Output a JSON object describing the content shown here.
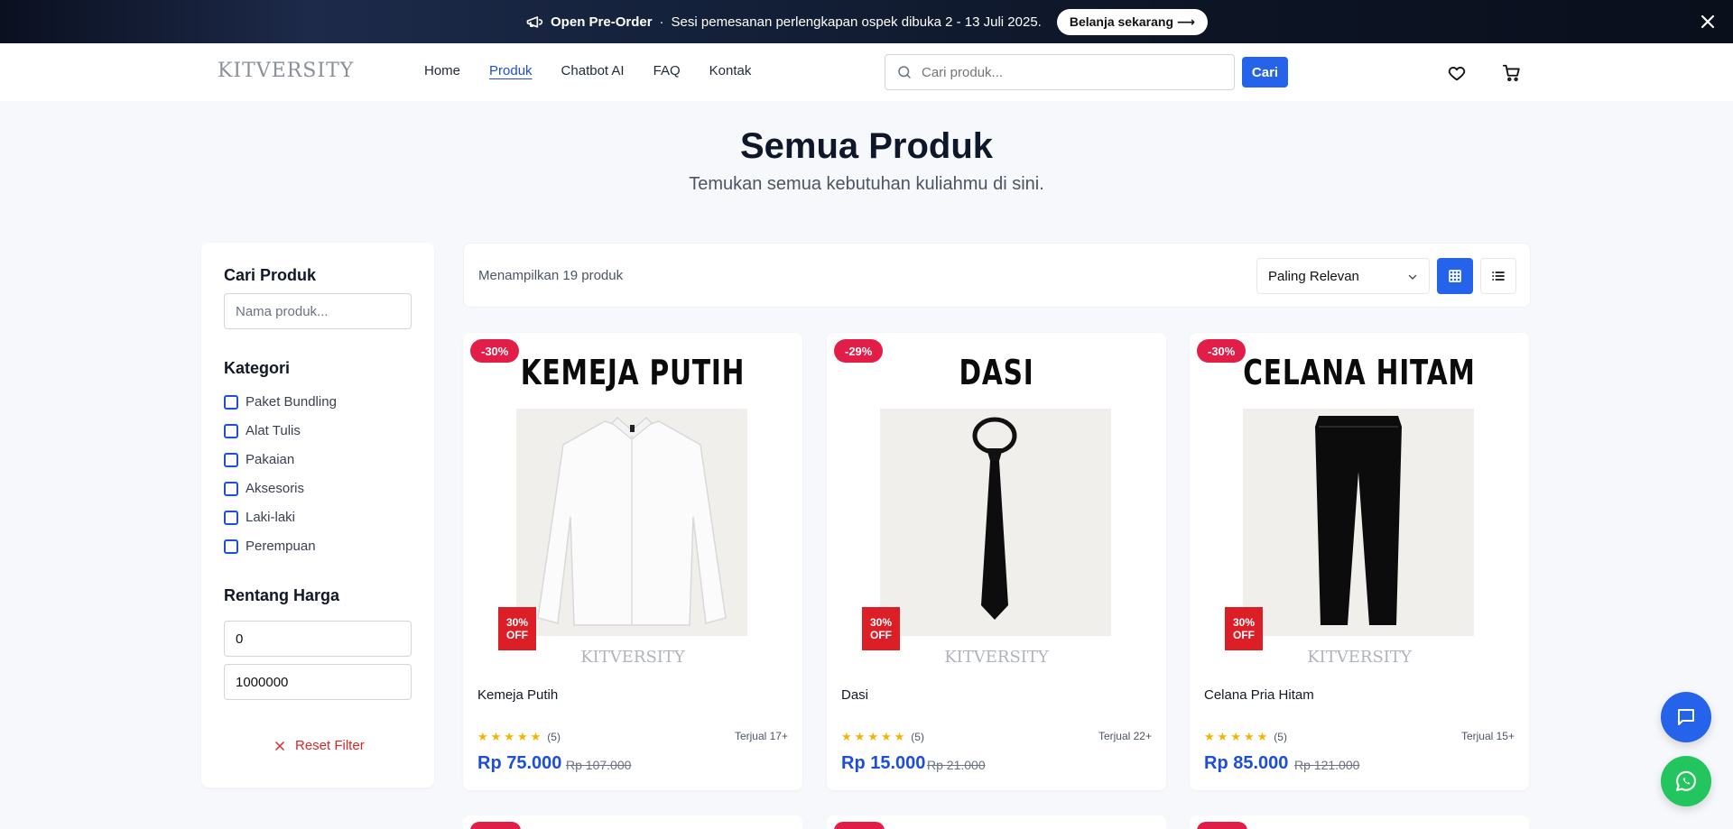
{
  "announcement": {
    "title": "Open Pre-Order",
    "separator": "·",
    "message": "Sesi pemesanan perlengkapan ospek dibuka 2 - 13 Juli 2025.",
    "cta": "Belanja sekarang ⟶"
  },
  "nav": {
    "logo": "KITVERSITY",
    "links": [
      "Home",
      "Produk",
      "Chatbot AI",
      "FAQ",
      "Kontak"
    ],
    "active_link": "Produk",
    "search_placeholder": "Cari produk...",
    "search_button": "Cari"
  },
  "hero": {
    "title": "Semua Produk",
    "subtitle": "Temukan semua kebutuhan kuliahmu di sini."
  },
  "sidebar": {
    "search_heading": "Cari Produk",
    "search_placeholder": "Nama produk...",
    "category_heading": "Kategori",
    "categories": [
      "Paket Bundling",
      "Alat Tulis",
      "Pakaian",
      "Aksesoris",
      "Laki-laki",
      "Perempuan"
    ],
    "price_heading": "Rentang Harga",
    "price_min": "0",
    "price_max": "1000000",
    "reset_label": "Reset Filter"
  },
  "toolbar": {
    "count_text": "Menampilkan 19 produk",
    "sort_value": "Paling Relevan"
  },
  "products": [
    {
      "badge": "-30%",
      "art_title": "KEMEJA PUTIH",
      "off_line1": "30%",
      "off_line2": "OFF",
      "watermark": "KITVERSITY",
      "name": "Kemeja Putih",
      "rating_count": "(5)",
      "sold": "Terjual 17+",
      "price": "Rp 75.000",
      "old_price": "Rp 107.000"
    },
    {
      "badge": "-29%",
      "art_title": "DASI",
      "off_line1": "30%",
      "off_line2": "OFF",
      "watermark": "KITVERSITY",
      "name": "Dasi",
      "rating_count": "(5)",
      "sold": "Terjual 22+",
      "price": "Rp 15.000",
      "old_price": "Rp 21.000"
    },
    {
      "badge": "-30%",
      "art_title": "CELANA HITAM",
      "off_line1": "30%",
      "off_line2": "OFF",
      "watermark": "KITVERSITY",
      "name": "Celana Pria Hitam",
      "rating_count": "(5)",
      "sold": "Terjual 15+",
      "price": "Rp 85.000",
      "old_price": "Rp 121.000"
    }
  ],
  "colors": {
    "primary": "#2563eb",
    "discount": "#e11d48",
    "whatsapp": "#22c55e",
    "star": "#f5b301"
  },
  "icons": [
    "megaphone-icon",
    "close-icon",
    "search-icon",
    "heart-icon",
    "cart-icon",
    "grid-view-icon",
    "list-view-icon",
    "chevron-down-icon",
    "chat-icon",
    "whatsapp-icon",
    "star-icon"
  ]
}
